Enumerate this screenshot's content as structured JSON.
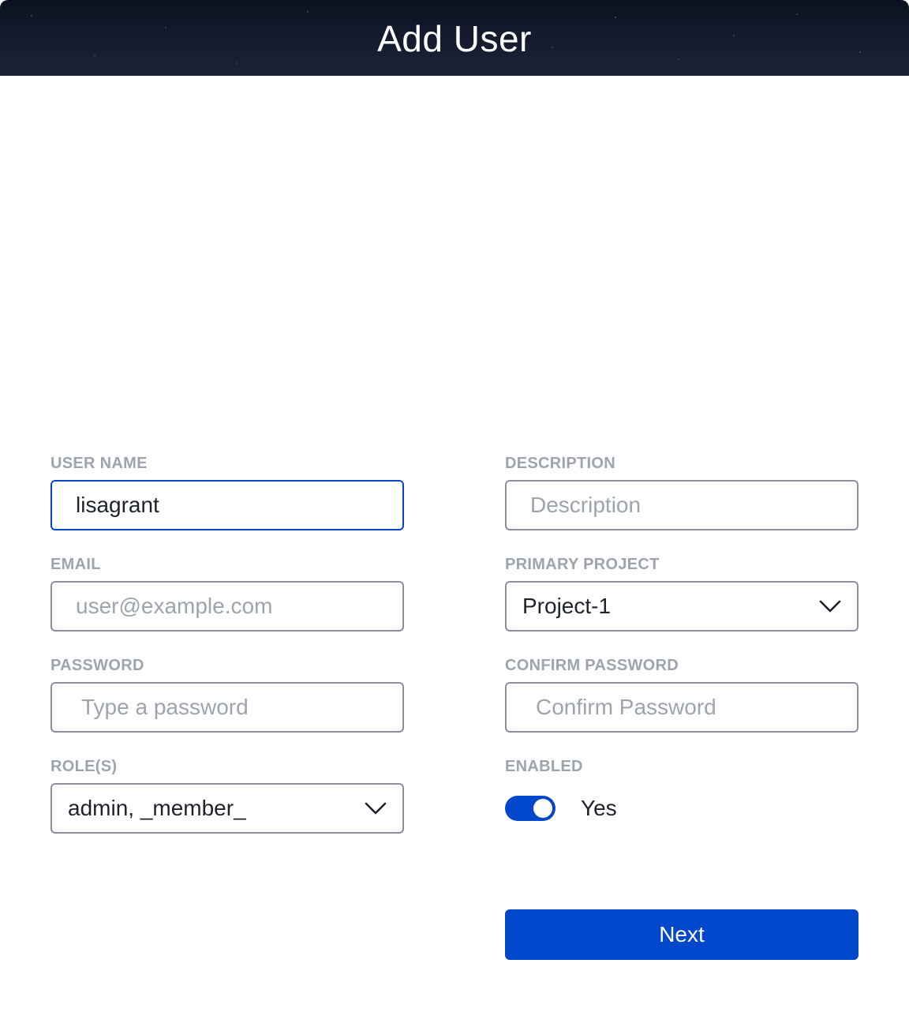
{
  "header": {
    "title": "Add User"
  },
  "form": {
    "user_name": {
      "label": "USER NAME",
      "value": "lisagrant",
      "placeholder": ""
    },
    "description": {
      "label": "DESCRIPTION",
      "value": "",
      "placeholder": "Description"
    },
    "email": {
      "label": "EMAIL",
      "value": "",
      "placeholder": "user@example.com"
    },
    "primary_project": {
      "label": "PRIMARY PROJECT",
      "selected": "Project-1"
    },
    "password": {
      "label": "PASSWORD",
      "value": "",
      "placeholder": "Type a password"
    },
    "confirm_password": {
      "label": "CONFIRM PASSWORD",
      "value": "",
      "placeholder": "Confirm Password"
    },
    "roles": {
      "label": "ROLE(S)",
      "selected": "admin, _member_"
    },
    "enabled": {
      "label": "ENABLED",
      "state": true,
      "state_label": "Yes"
    }
  },
  "actions": {
    "next_label": "Next"
  },
  "colors": {
    "accent": "#0047cc",
    "label": "#9ea4ae",
    "border": "#8a909b",
    "text": "#1e232b"
  },
  "icons": {
    "dropdown": "chevron-down-icon"
  }
}
